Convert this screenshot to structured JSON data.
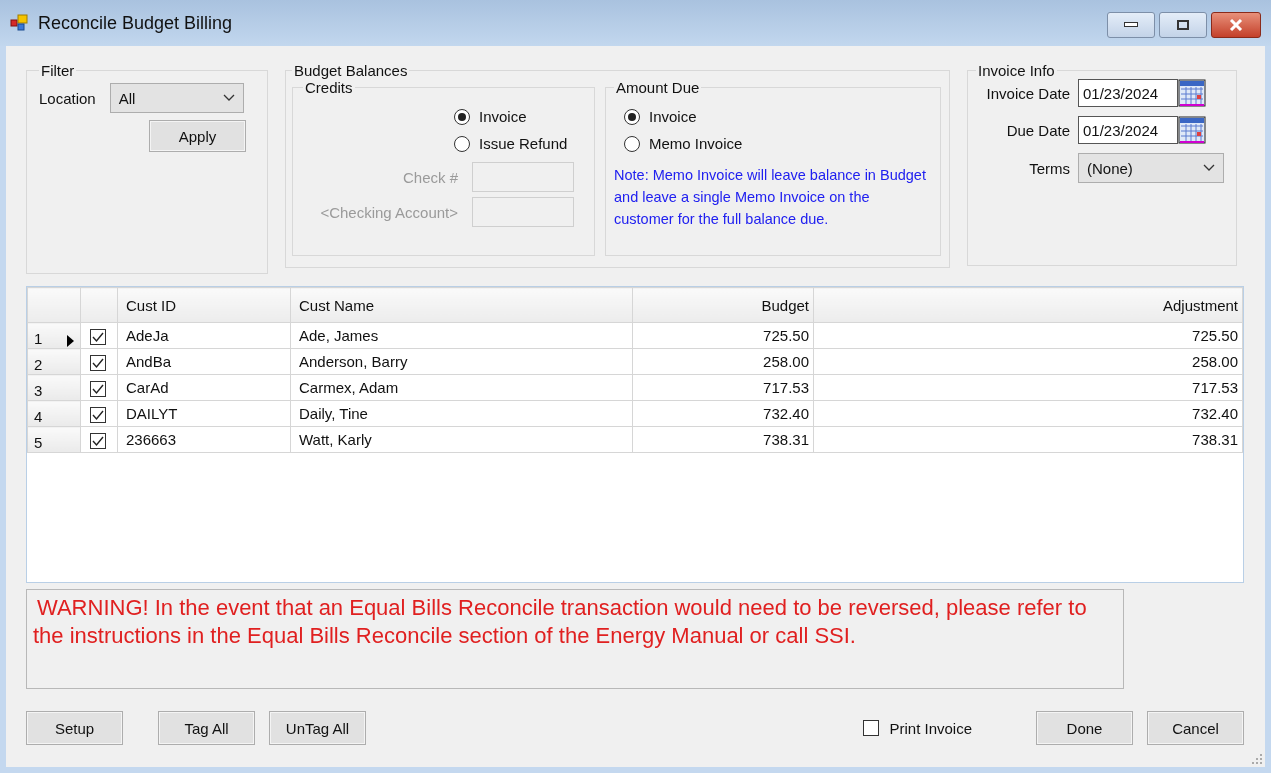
{
  "window": {
    "title": "Reconcile Budget Billing"
  },
  "filter": {
    "legend": "Filter",
    "location_label": "Location",
    "location_value": "All",
    "apply_button": "Apply"
  },
  "budget_balances": {
    "legend": "Budget Balances",
    "credits": {
      "legend": "Credits",
      "options": [
        {
          "label": "Invoice",
          "selected": true
        },
        {
          "label": "Issue Refund",
          "selected": false
        }
      ],
      "check_label": "Check #",
      "account_label": "<Checking Account>"
    },
    "amount_due": {
      "legend": "Amount Due",
      "options": [
        {
          "label": "Invoice",
          "selected": true
        },
        {
          "label": "Memo Invoice",
          "selected": false
        }
      ],
      "note": "Note: Memo Invoice will leave balance in Budget and leave a single Memo Invoice on the customer for the full balance due."
    }
  },
  "invoice_info": {
    "legend": "Invoice Info",
    "invoice_date_label": "Invoice Date",
    "invoice_date": "01/23/2024",
    "due_date_label": "Due Date",
    "due_date": "01/23/2024",
    "terms_label": "Terms",
    "terms": "(None)"
  },
  "table": {
    "columns": [
      "Cust ID",
      "Cust Name",
      "Budget",
      "Adjustment"
    ],
    "rows": [
      {
        "number": "1",
        "current": true,
        "tagged": true,
        "cust_id": "AdeJa",
        "cust_name": "Ade, James",
        "budget": "725.50",
        "adjustment": "725.50"
      },
      {
        "number": "2",
        "current": false,
        "tagged": true,
        "cust_id": "AndBa",
        "cust_name": "Anderson, Barry",
        "budget": "258.00",
        "adjustment": "258.00"
      },
      {
        "number": "3",
        "current": false,
        "tagged": true,
        "cust_id": "CarAd",
        "cust_name": "Carmex, Adam",
        "budget": "717.53",
        "adjustment": "717.53"
      },
      {
        "number": "4",
        "current": false,
        "tagged": true,
        "cust_id": "DAILYT",
        "cust_name": "Daily, Tine",
        "budget": "732.40",
        "adjustment": "732.40"
      },
      {
        "number": "5",
        "current": false,
        "tagged": true,
        "cust_id": "236663",
        "cust_name": "Watt, Karly",
        "budget": "738.31",
        "adjustment": "738.31"
      }
    ]
  },
  "warning": "WARNING! In the event that an Equal Bills Reconcile transaction would need to be reversed, please refer to the instructions in the Equal Bills Reconcile section of the Energy Manual or call SSI.",
  "left_buttons": [
    "Setup",
    "Tag All",
    "UnTag All"
  ],
  "print_invoice": {
    "label": "Print Invoice",
    "checked": false
  },
  "right_buttons": [
    "Done",
    "Cancel"
  ]
}
